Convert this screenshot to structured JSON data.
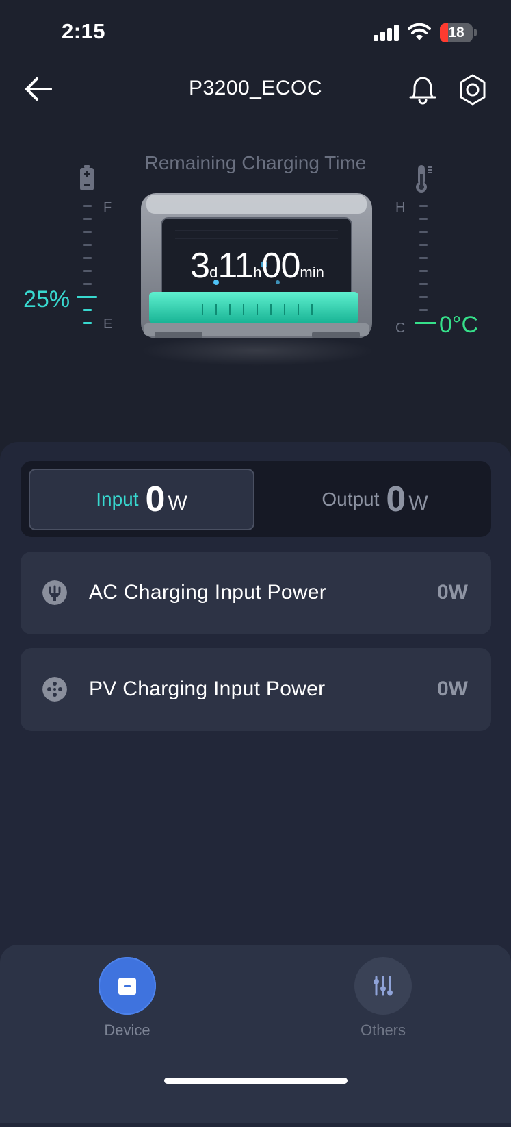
{
  "status_bar": {
    "time": "2:15",
    "battery_level": "18"
  },
  "header": {
    "title": "P3200_ECOC"
  },
  "hero": {
    "remaining_label": "Remaining Charging Time",
    "countdown": {
      "days": "3",
      "days_unit": "d",
      "hours": "11",
      "hours_unit": "h",
      "minutes": "00",
      "minutes_unit": "min"
    },
    "soc": {
      "value": "25%",
      "level_fraction": 0.25,
      "top_letter": "F",
      "bottom_letter": "E"
    },
    "temperature": {
      "value": "0°C",
      "top_letter": "H",
      "bottom_letter": "C"
    }
  },
  "power_tabs": {
    "input": {
      "label": "Input",
      "value": "0",
      "unit": "W"
    },
    "output": {
      "label": "Output",
      "value": "0",
      "unit": "W"
    }
  },
  "input_cards": [
    {
      "label": "AC Charging Input Power",
      "value": "0W",
      "icon": "plug-icon"
    },
    {
      "label": "PV Charging Input Power",
      "value": "0W",
      "icon": "solar-icon"
    }
  ],
  "nav": {
    "device_label": "Device",
    "others_label": "Others"
  },
  "colors": {
    "background": "#1d212d",
    "accent_teal": "#38d8cf",
    "temperature_green": "#36e08a",
    "nav_active": "#3f73de"
  }
}
